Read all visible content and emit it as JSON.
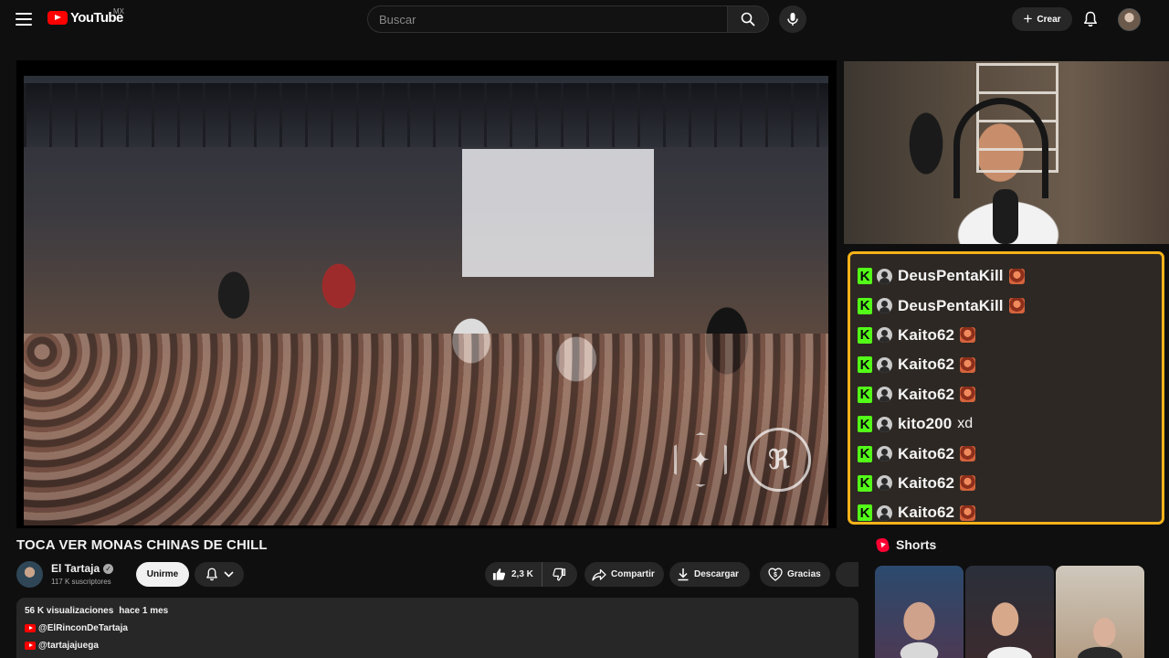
{
  "masthead": {
    "logo_text": "YouTube",
    "country_code": "MX",
    "search_placeholder": "Buscar",
    "create_label": "Crear",
    "icons": [
      "menu-icon",
      "search-icon",
      "mic-icon",
      "plus-icon",
      "bell-icon"
    ]
  },
  "video": {
    "title": "TOCA VER MONAS CHINAS DE CHILL",
    "channel_name": "El Tartaja",
    "subscribers": "117 K suscriptores",
    "join_label": "Unirme",
    "likes": "2,3 K",
    "share_label": "Compartir",
    "download_label": "Descargar",
    "thanks_label": "Gracias"
  },
  "description": {
    "views": "56 K visualizaciones",
    "date": "hace 1 mes",
    "links": [
      "@ElRinconDeTartaja",
      "@tartajajuega"
    ]
  },
  "chat": {
    "border_color": "#f5b21a",
    "badge_color": "#53fc18",
    "messages": [
      {
        "user": "DeusPentaKill",
        "text": "",
        "emote": true
      },
      {
        "user": "DeusPentaKill",
        "text": "",
        "emote": true
      },
      {
        "user": "Kaito62",
        "text": "",
        "emote": true
      },
      {
        "user": "Kaito62",
        "text": "",
        "emote": true
      },
      {
        "user": "Kaito62",
        "text": "",
        "emote": true
      },
      {
        "user": "kito200",
        "text": "xd",
        "emote": false
      },
      {
        "user": "Kaito62",
        "text": "",
        "emote": true
      },
      {
        "user": "Kaito62",
        "text": "",
        "emote": true
      },
      {
        "user": "Kaito62",
        "text": "",
        "emote": true
      }
    ]
  },
  "shorts": {
    "title": "Shorts",
    "count_visible": 3
  }
}
